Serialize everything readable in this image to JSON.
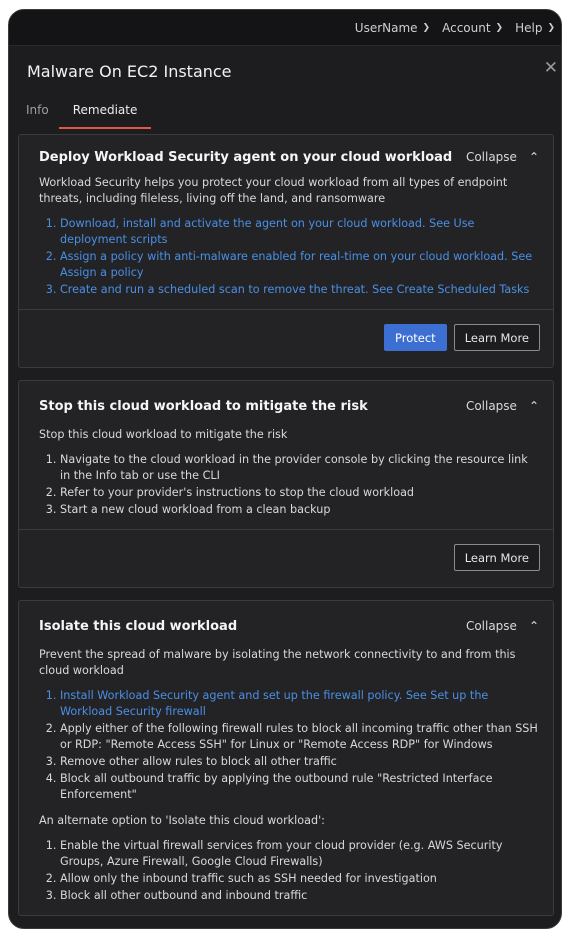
{
  "topbar": {
    "items": [
      {
        "label": "UserName",
        "icon": "chevron-down-icon"
      },
      {
        "label": "Account",
        "icon": "chevron-down-icon"
      },
      {
        "label": "Help",
        "icon": "chevron-down-icon"
      }
    ]
  },
  "panel": {
    "title": "Malware On EC2 Instance",
    "close_icon": "close-icon",
    "tabs": [
      {
        "label": "Info",
        "active": false
      },
      {
        "label": "Remediate",
        "active": true
      }
    ]
  },
  "cards": [
    {
      "title": "Deploy Workload Security agent on your cloud workload",
      "collapse_label": "Collapse",
      "description": "Workload Security helps you protect your cloud workload from all types of endpoint threats, including fileless, living off the land, and ransomware",
      "steps": [
        "Download, install and activate the agent on your cloud workload. See Use deployment scripts",
        "Assign a policy with anti-malware enabled for real-time on your cloud workload. See Assign a policy",
        "Create and run a scheduled scan to remove the threat. See Create Scheduled Tasks"
      ],
      "primary_button": "Protect",
      "secondary_button": "Learn More"
    },
    {
      "title": "Stop this cloud workload to mitigate the risk",
      "collapse_label": "Collapse",
      "description": "Stop this cloud workload to mitigate the risk",
      "steps": [
        "Navigate to the cloud workload in the provider console by clicking the resource link in the Info tab or use the CLI",
        "Refer to your provider's instructions to stop the cloud workload",
        "Start a new cloud workload from a clean backup"
      ],
      "secondary_button": "Learn More"
    },
    {
      "title": "Isolate this cloud workload",
      "collapse_label": "Collapse",
      "description": "Prevent the spread of malware by isolating the network connectivity to and from this cloud workload",
      "steps": [
        "Install Workload Security agent and set up the firewall policy. See Set up the Workload Security firewall",
        "Apply either of the following firewall rules to block all incoming traffic other than SSH or RDP: \"Remote Access SSH\" for Linux or \"Remote Access RDP\" for Windows",
        "Remove other allow rules to block all other traffic",
        "Block all outbound traffic by applying the outbound rule \"Restricted Interface Enforcement\""
      ],
      "alternate_intro": "An alternate option to 'Isolate this cloud workload':",
      "alternate_steps": [
        "Enable the virtual firewall services from your cloud provider (e.g. AWS Security Groups, Azure Firewall, Google Cloud Firewalls)",
        "Allow only the inbound traffic such as SSH needed for investigation",
        "Block all other outbound and inbound traffic"
      ]
    }
  ],
  "colors": {
    "link": "#4a8fe6",
    "primary_button": "#3d6fd2",
    "active_tab_underline": "#e2574c",
    "panel_bg": "#1d1d1f"
  }
}
